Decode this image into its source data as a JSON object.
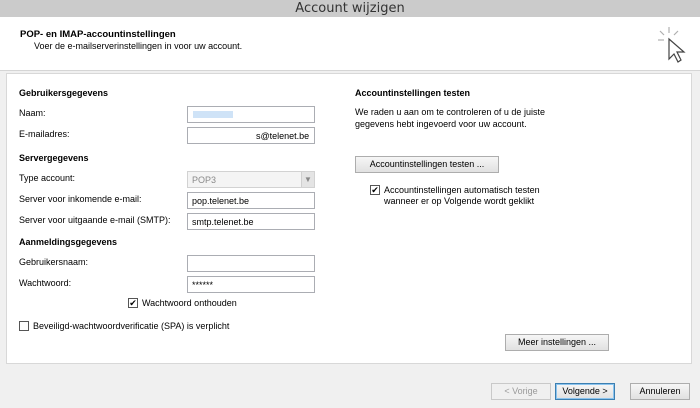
{
  "window": {
    "title": "Account wijzigen"
  },
  "header": {
    "title": "POP- en IMAP-accountinstellingen",
    "subtitle": "Voer de e-mailserverinstellingen in voor uw account."
  },
  "user_info": {
    "heading": "Gebruikersgegevens",
    "name_label": "Naam:",
    "email_label": "E-mailadres:",
    "email_value": "s@telenet.be"
  },
  "server_info": {
    "heading": "Servergegevens",
    "account_type_label": "Type account:",
    "account_type_value": "POP3",
    "incoming_label": "Server voor inkomende e-mail:",
    "incoming_value": "pop.telenet.be",
    "outgoing_label": "Server voor uitgaande e-mail (SMTP):",
    "outgoing_value": "smtp.telenet.be"
  },
  "login_info": {
    "heading": "Aanmeldingsgegevens",
    "username_label": "Gebruikersnaam:",
    "password_label": "Wachtwoord:",
    "password_value": "******",
    "remember_label": "Wachtwoord onthouden",
    "remember_checked": true,
    "spa_label": "Beveiligd-wachtwoordverificatie (SPA) is verplicht",
    "spa_checked": false
  },
  "test_settings": {
    "heading": "Accountinstellingen testen",
    "description_line1": "We raden u aan om te controleren of u de juiste",
    "description_line2": "gegevens hebt ingevoerd voor uw account.",
    "test_button": "Accountinstellingen testen ...",
    "auto_test_line1": "Accountinstellingen automatisch testen",
    "auto_test_line2": "wanneer er op Volgende wordt geklikt",
    "auto_test_checked": true
  },
  "more_settings_button": "Meer instellingen ...",
  "footer": {
    "back_button": "< Vorige",
    "next_button": "Volgende >",
    "cancel_button": "Annuleren"
  },
  "icons": {
    "cursor": "cursor-click-icon",
    "checkmark": "checkmark-icon",
    "dropdown": "chevron-down-icon"
  }
}
